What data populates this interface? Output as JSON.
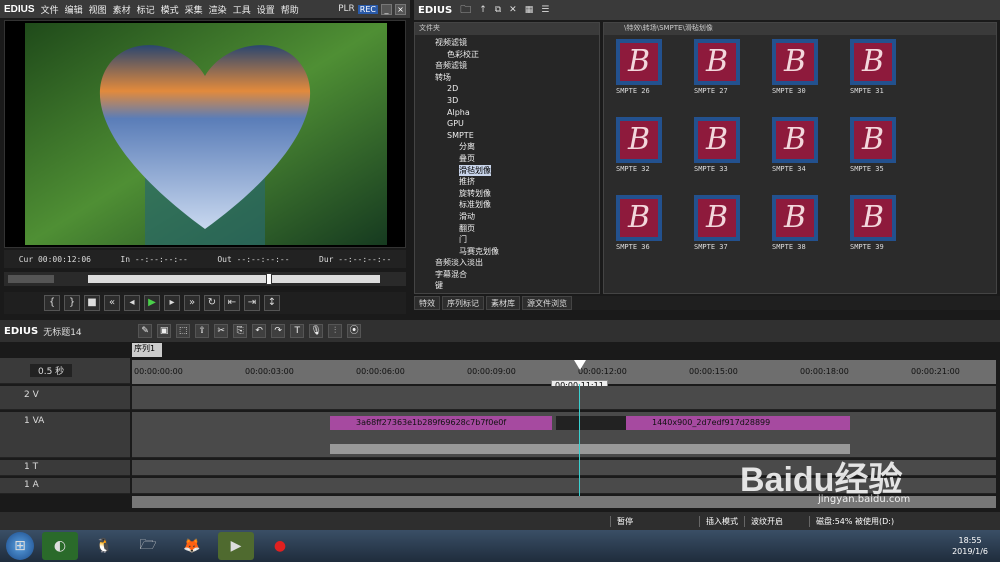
{
  "app": {
    "name": "EDIUS",
    "plr": "PLR",
    "rec": "REC"
  },
  "menu": [
    "文件",
    "编辑",
    "视图",
    "素材",
    "标记",
    "模式",
    "采集",
    "渲染",
    "工具",
    "设置",
    "帮助"
  ],
  "preview": {
    "cur": "Cur 00:00:12:06",
    "in": "In --:--:--:--",
    "out": "Out --:--:--:--",
    "dur": "Dur --:--:--:--"
  },
  "library": {
    "folder_header": "文件夹",
    "path": "\\特效\\转场\\SMPTE\\滑毡划像",
    "tree": [
      {
        "label": "视频滤镜",
        "indent": 1
      },
      {
        "label": "色彩校正",
        "indent": 2
      },
      {
        "label": "音频滤镜",
        "indent": 1
      },
      {
        "label": "转场",
        "indent": 1
      },
      {
        "label": "2D",
        "indent": 2
      },
      {
        "label": "3D",
        "indent": 2
      },
      {
        "label": "Alpha",
        "indent": 2
      },
      {
        "label": "GPU",
        "indent": 2
      },
      {
        "label": "SMPTE",
        "indent": 2
      },
      {
        "label": "分离",
        "indent": 3
      },
      {
        "label": "叠页",
        "indent": 3
      },
      {
        "label": "滑毡划像",
        "indent": 3,
        "selected": true
      },
      {
        "label": "推挤",
        "indent": 3
      },
      {
        "label": "旋转划像",
        "indent": 3
      },
      {
        "label": "标准划像",
        "indent": 3
      },
      {
        "label": "滑动",
        "indent": 3
      },
      {
        "label": "翻页",
        "indent": 3
      },
      {
        "label": "门",
        "indent": 3
      },
      {
        "label": "马赛克划像",
        "indent": 3
      },
      {
        "label": "音频淡入淡出",
        "indent": 1
      },
      {
        "label": "字幕混合",
        "indent": 1
      },
      {
        "label": "键",
        "indent": 1
      }
    ],
    "thumbs": [
      "SMPTE 26",
      "SMPTE 27",
      "SMPTE 30",
      "SMPTE 31",
      "SMPTE 32",
      "SMPTE 33",
      "SMPTE 34",
      "SMPTE 35",
      "SMPTE 36",
      "SMPTE 37",
      "SMPTE 38",
      "SMPTE 39"
    ],
    "tabs": [
      "特效",
      "序列标记",
      "素材库",
      "源文件浏览"
    ]
  },
  "timeline": {
    "title": "EDIUS",
    "project": "无标题14",
    "sequence": "序列1",
    "zoom": "0.5 秒",
    "ruler": [
      "00:00:00:00",
      "00:00:03:00",
      "00:00:06:00",
      "00:00:09:00",
      "00:00:12:00",
      "00:00:15:00",
      "00:00:18:00",
      "00:00:21:00"
    ],
    "cursor_tc": "00:00:11:11",
    "tracks": [
      "2 V",
      "1 VA",
      "1 T",
      "1 A"
    ],
    "clip1": "3a68ff27363e1b289f69628c7b7f0e0f",
    "clip2": "1440x900_2d7edf917d28899"
  },
  "status": [
    "暂停",
    "插入模式",
    "波纹开启",
    "磁盘:54% 被使用(D:)"
  ],
  "taskbar": {
    "time": "18:55",
    "date": "2019/1/6"
  },
  "watermark": "Baidu经验",
  "watermark_url": "jingyan.baidu.com"
}
